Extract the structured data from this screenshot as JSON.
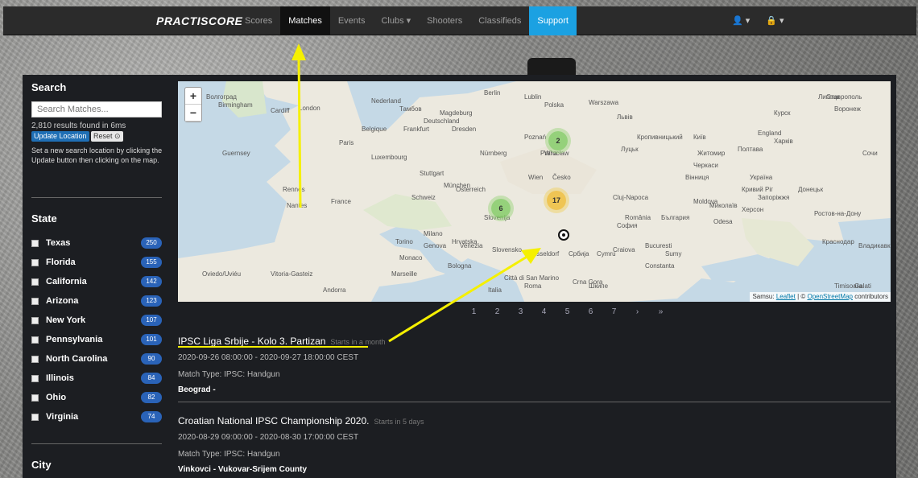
{
  "nav": {
    "logo": "PRACTISCORE",
    "items": [
      "Scores",
      "Matches",
      "Events",
      "Clubs ▾",
      "Shooters",
      "Classifieds",
      "Support"
    ],
    "active": "Matches",
    "user_label": "👤 ▾",
    "lock_label": "🔒 ▾"
  },
  "sidebar": {
    "search_heading": "Search",
    "search_placeholder": "Search Matches...",
    "results": "2,810 results found in 6ms",
    "update_label": "Update Location",
    "reset_label": "Reset ⊙",
    "help": "Set a new search location by clicking the Update button then clicking on the map.",
    "state_heading": "State",
    "states": [
      {
        "name": "Texas",
        "count": "250"
      },
      {
        "name": "Florida",
        "count": "155"
      },
      {
        "name": "California",
        "count": "142"
      },
      {
        "name": "Arizona",
        "count": "123"
      },
      {
        "name": "New York",
        "count": "107"
      },
      {
        "name": "Pennsylvania",
        "count": "101"
      },
      {
        "name": "North Carolina",
        "count": "90"
      },
      {
        "name": "Illinois",
        "count": "84"
      },
      {
        "name": "Ohio",
        "count": "82"
      },
      {
        "name": "Virginia",
        "count": "74"
      }
    ],
    "city_heading": "City"
  },
  "map": {
    "zoom_in": "+",
    "zoom_out": "−",
    "clusters": [
      "2",
      "17",
      "6"
    ],
    "attribution_prefix": "Samsu: ",
    "leaflet": "Leaflet",
    "attr_sep": " | © ",
    "osm": "OpenStreetMap",
    "attr_suffix": " contributors",
    "labels": [
      "London",
      "Cardiff",
      "Paris",
      "Nederland",
      "Belgique",
      "Deutschland",
      "Berlin",
      "Polska",
      "Warszawa",
      "France",
      "Schweiz",
      "Österreich",
      "Italia",
      "Slovenija",
      "România",
      "Србија",
      "Magdeburg",
      "Dresden",
      "Praha",
      "München",
      "Wien",
      "Milano",
      "Torino",
      "Monaco",
      "Genova",
      "Venezia",
      "Marseille",
      "Andorra",
      "Vitoria-Gasteiz",
      "Oviedo/Uviéu",
      "Nantes",
      "Rennes",
      "Guernsey",
      "Luxembourg",
      "Frankfurt",
      "Stuttgart",
      "Nürnberg",
      "Cluj-Napoca",
      "Craiova",
      "Bucuresti",
      "Constanta",
      "Moldova",
      "Odesa",
      "Україна",
      "Кривий Ріг",
      "Запоріжжя",
      "Миколаїв",
      "Херсон",
      "Донецьк",
      "Ростов-на-Дону",
      "Краснодар",
      "Воронеж",
      "Липецк",
      "Курск",
      "Харків",
      "Полтава",
      "Київ",
      "Житомир",
      "Черкаси",
      "Вінниця",
      "Кропивницький",
      "Луцьк",
      "Львів",
      "Lublin",
      "Poznań",
      "Wrocław",
      "Česko",
      "Slovensko",
      "Hrvatska",
      "Bologna",
      "Città di San Marino",
      "Roma",
      "Crna Gora",
      "Шкипе",
      "София",
      "България",
      "Timisoara",
      "Galati",
      "Владикавказ",
      "Сочи",
      "Ставрополь",
      "Волгоград",
      "Тамбов",
      "Birmingham",
      "England",
      "Dusseldorf",
      "Cymru",
      "Sumy"
    ]
  },
  "pagination": [
    "1",
    "2",
    "3",
    "4",
    "5",
    "6",
    "7",
    "›",
    "»"
  ],
  "matches": [
    {
      "title": "IPSC Liga Srbije - Kolo 3. Partizan",
      "soon": "Starts in a month",
      "date": "2020-09-26 08:00:00 - 2020-09-27 18:00:00 CEST",
      "type": "Match Type: IPSC: Handgun",
      "location": "Beograd -"
    },
    {
      "title": "Croatian National IPSC Championship 2020.",
      "soon": "Starts in 5 days",
      "date": "2020-08-29 09:00:00 - 2020-08-30 17:00:00 CEST",
      "type": "Match Type: IPSC: Handgun",
      "location": "Vinkovci - Vukovar-Srijem County"
    }
  ],
  "colors": {
    "accent": "#1ba1e2",
    "badge": "#2a63b8",
    "annotation": "#f5f000"
  }
}
